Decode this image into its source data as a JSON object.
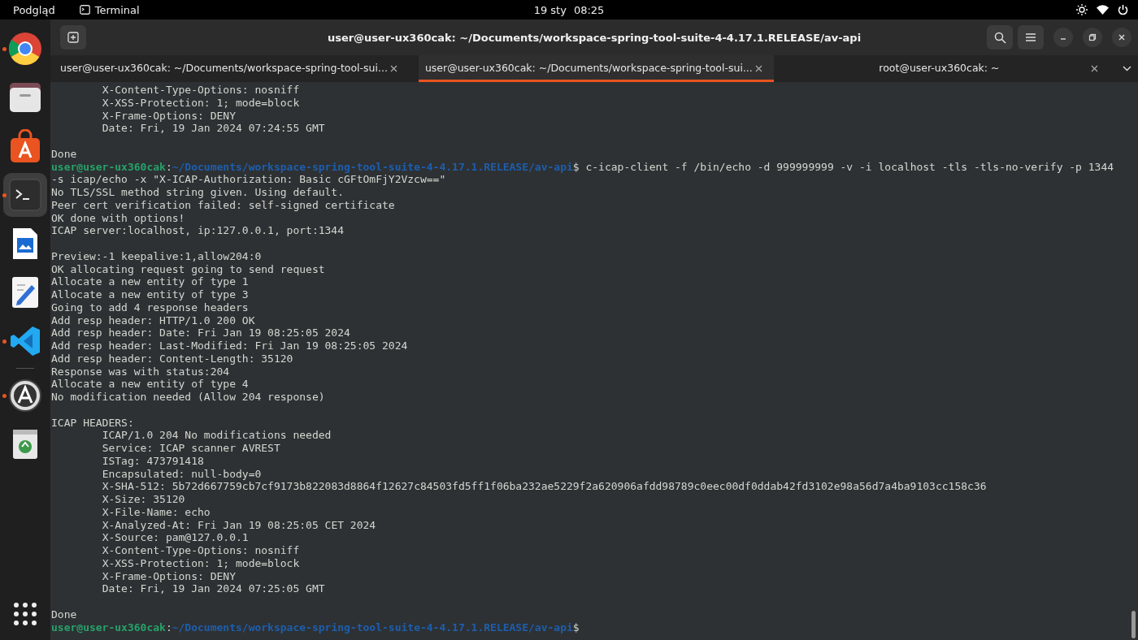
{
  "top_bar": {
    "activities": "Podgląd",
    "app": "Terminal",
    "date": "19 sty",
    "time": "08:25"
  },
  "dock": {
    "items": [
      {
        "kind": "browser",
        "running": true,
        "selected": false
      },
      {
        "kind": "files",
        "running": false,
        "selected": false
      },
      {
        "kind": "store",
        "running": false,
        "selected": false
      },
      {
        "kind": "terminal",
        "running": true,
        "selected": true
      },
      {
        "kind": "document",
        "running": false,
        "selected": false
      },
      {
        "kind": "editor",
        "running": false,
        "selected": false
      },
      {
        "kind": "code",
        "running": true,
        "selected": false
      },
      {
        "kind": "separator"
      },
      {
        "kind": "updater",
        "running": true,
        "selected": false
      },
      {
        "kind": "trash",
        "running": false,
        "selected": false
      }
    ]
  },
  "window": {
    "title": "user@user-ux360cak: ~/Documents/workspace-spring-tool-suite-4-4.17.1.RELEASE/av-api"
  },
  "tabs": [
    {
      "label": "user@user-ux360cak: ~/Documents/workspace-spring-tool-sui...",
      "selected": false
    },
    {
      "label": "user@user-ux360cak: ~/Documents/workspace-spring-tool-sui...",
      "selected": true
    },
    {
      "label": "root@user-ux360cak: ~",
      "selected": false
    }
  ],
  "terminal": {
    "lines": [
      {
        "kind": "output",
        "text": "\tX-Content-Type-Options: nosniff"
      },
      {
        "kind": "output",
        "text": "\tX-XSS-Protection: 1; mode=block"
      },
      {
        "kind": "output",
        "text": "\tX-Frame-Options: DENY"
      },
      {
        "kind": "output",
        "text": "\tDate: Fri, 19 Jan 2024 07:24:55 GMT"
      },
      {
        "kind": "blank"
      },
      {
        "kind": "output",
        "text": "Done"
      },
      {
        "kind": "prompt",
        "user": "user@user-ux360cak",
        "separator": ":",
        "path": "~/Documents/workspace-spring-tool-suite-4-4.17.1.RELEASE/av-api",
        "symbol": "$",
        "command": "c-icap-client -f /bin/echo -d 999999999 -v -i localhost -tls -tls-no-verify -p 1344"
      },
      {
        "kind": "output",
        "text": "-s icap/echo -x \"X-ICAP-Authorization: Basic cGFtOmFjY2Vzcw==\""
      },
      {
        "kind": "output",
        "text": "No TLS/SSL method string given. Using default."
      },
      {
        "kind": "output",
        "text": "Peer cert verification failed: self-signed certificate"
      },
      {
        "kind": "output",
        "text": "OK done with options!"
      },
      {
        "kind": "output",
        "text": "ICAP server:localhost, ip:127.0.0.1, port:1344"
      },
      {
        "kind": "blank"
      },
      {
        "kind": "output",
        "text": "Preview:-1 keepalive:1,allow204:0"
      },
      {
        "kind": "output",
        "text": "OK allocating request going to send request"
      },
      {
        "kind": "output",
        "text": "Allocate a new entity of type 1"
      },
      {
        "kind": "output",
        "text": "Allocate a new entity of type 3"
      },
      {
        "kind": "output",
        "text": "Going to add 4 response headers"
      },
      {
        "kind": "output",
        "text": "Add resp header: HTTP/1.0 200 OK"
      },
      {
        "kind": "output",
        "text": "Add resp header: Date: Fri Jan 19 08:25:05 2024"
      },
      {
        "kind": "output",
        "text": "Add resp header: Last-Modified: Fri Jan 19 08:25:05 2024"
      },
      {
        "kind": "output",
        "text": "Add resp header: Content-Length: 35120"
      },
      {
        "kind": "output",
        "text": "Response was with status:204"
      },
      {
        "kind": "output",
        "text": "Allocate a new entity of type 4"
      },
      {
        "kind": "output",
        "text": "No modification needed (Allow 204 response)"
      },
      {
        "kind": "blank"
      },
      {
        "kind": "output",
        "text": "ICAP HEADERS:"
      },
      {
        "kind": "output",
        "text": "\tICAP/1.0 204 No modifications needed"
      },
      {
        "kind": "output",
        "text": "\tService: ICAP scanner AVREST"
      },
      {
        "kind": "output",
        "text": "\tISTag: 473791418"
      },
      {
        "kind": "output",
        "text": "\tEncapsulated: null-body=0"
      },
      {
        "kind": "output",
        "text": "\tX-SHA-512: 5b72d667759cb7cf9173b822083d8864f12627c84503fd5ff1f06ba232ae5229f2a620906afdd98789c0eec00df0ddab42fd3102e98a56d7a4ba9103cc158c36"
      },
      {
        "kind": "output",
        "text": "\tX-Size: 35120"
      },
      {
        "kind": "output",
        "text": "\tX-File-Name: echo"
      },
      {
        "kind": "output",
        "text": "\tX-Analyzed-At: Fri Jan 19 08:25:05 CET 2024"
      },
      {
        "kind": "output",
        "text": "\tX-Source: pam@127.0.0.1"
      },
      {
        "kind": "output",
        "text": "\tX-Content-Type-Options: nosniff"
      },
      {
        "kind": "output",
        "text": "\tX-XSS-Protection: 1; mode=block"
      },
      {
        "kind": "output",
        "text": "\tX-Frame-Options: DENY"
      },
      {
        "kind": "output",
        "text": "\tDate: Fri, 19 Jan 2024 07:25:05 GMT"
      },
      {
        "kind": "blank"
      },
      {
        "kind": "output",
        "text": "Done"
      },
      {
        "kind": "prompt",
        "user": "user@user-ux360cak",
        "separator": ":",
        "path": "~/Documents/workspace-spring-tool-suite-4-4.17.1.RELEASE/av-api",
        "symbol": "$"
      }
    ]
  }
}
